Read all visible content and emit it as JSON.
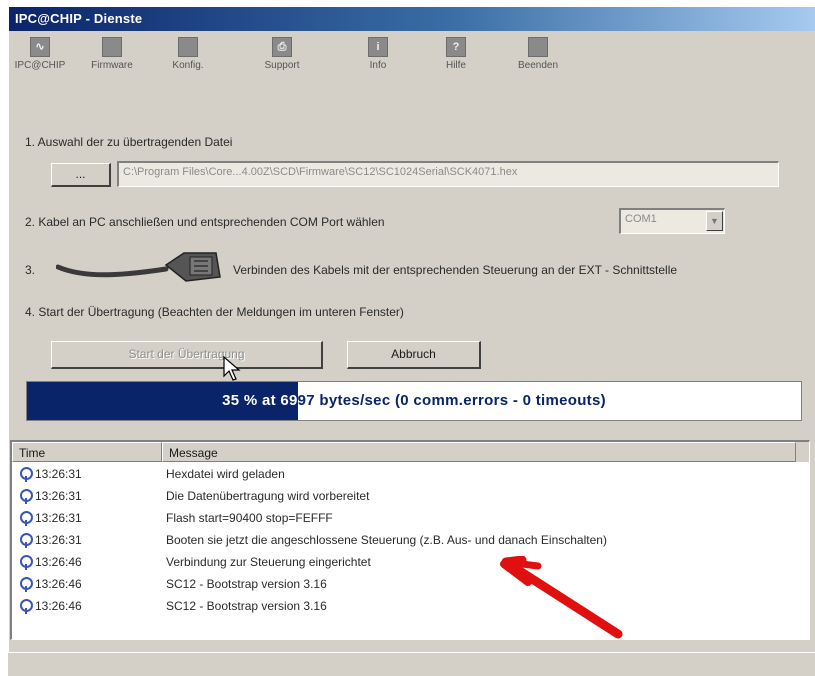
{
  "window": {
    "title": "IPC@CHIP - Dienste"
  },
  "toolbar": {
    "items": [
      {
        "label": "IPC@CHIP",
        "icon": "chip-icon",
        "glyph": "∿"
      },
      {
        "label": "Firmware",
        "icon": "firmware-icon",
        "glyph": ""
      },
      {
        "label": "Konfig.",
        "icon": "config-icon",
        "glyph": ""
      },
      {
        "label": "Support",
        "icon": "support-icon",
        "glyph": "⎙"
      },
      {
        "label": "Info",
        "icon": "info-icon",
        "glyph": "i"
      },
      {
        "label": "Hilfe",
        "icon": "help-icon",
        "glyph": "?"
      },
      {
        "label": "Beenden",
        "icon": "exit-icon",
        "glyph": ""
      }
    ]
  },
  "steps": {
    "step1": "1. Auswahl der zu übertragenden Datei",
    "browse_label": "...",
    "file_path": "C:\\Program Files\\Core...4.00Z\\SCD\\Firmware\\SC12\\SC1024Serial\\SCK4071.hex",
    "step2": "2. Kabel an PC anschließen und entsprechenden COM Port wählen",
    "com_port": "COM1",
    "step3_num": "3.",
    "step3_text": "Verbinden des Kabels mit der entsprechenden Steuerung an der EXT - Schnittstelle",
    "step4": "4. Start der Übertragung (Beachten der Meldungen im unteren Fenster)",
    "start_label": "Start der Übertragung",
    "cancel_label": "Abbruch"
  },
  "progress": {
    "fraction": 0.35,
    "text": "35 % at 6997 bytes/sec (0 comm.errors - 0 timeouts)"
  },
  "log": {
    "columns": [
      "Time",
      "Message"
    ],
    "rows": [
      {
        "time": "13:26:31",
        "message": "Hexdatei wird geladen"
      },
      {
        "time": "13:26:31",
        "message": "Die Datenübertragung wird vorbereitet"
      },
      {
        "time": "13:26:31",
        "message": "Flash start=90400 stop=FEFFF"
      },
      {
        "time": "13:26:31",
        "message": "Booten sie jetzt die angeschlossene Steuerung (z.B. Aus- und danach Einschalten)"
      },
      {
        "time": "13:26:46",
        "message": "Verbindung zur Steuerung eingerichtet"
      },
      {
        "time": "13:26:46",
        "message": "SC12 - Bootstrap version 3.16"
      },
      {
        "time": "13:26:46",
        "message": "SC12 - Bootstrap version 3.16"
      }
    ]
  },
  "colors": {
    "accent": "#0a246a",
    "annotation": "#e01010"
  }
}
